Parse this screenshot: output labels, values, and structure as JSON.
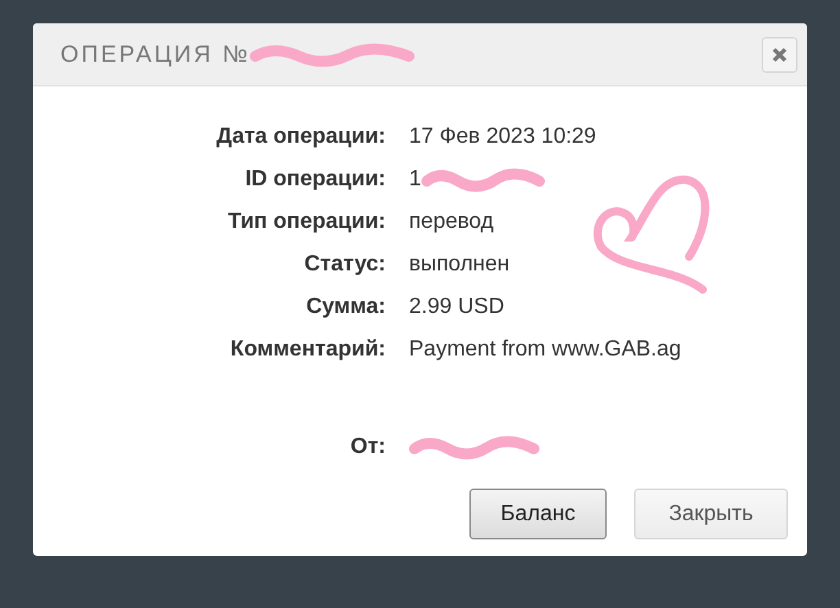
{
  "dialog": {
    "title": "ОПЕРАЦИЯ №",
    "title_redacted": true
  },
  "fields": [
    {
      "label": "Дата операции:",
      "value": "17 Фев 2023 10:29",
      "redacted": false
    },
    {
      "label": "ID операции:",
      "value": "1",
      "redacted": true
    },
    {
      "label": "Тип операции:",
      "value": "перевод",
      "redacted": false
    },
    {
      "label": "Статус:",
      "value": "выполнен",
      "redacted": false
    },
    {
      "label": "Сумма:",
      "value": "2.99 USD",
      "redacted": false
    },
    {
      "label": "Комментарий:",
      "value": "Payment from www.GAB.ag",
      "redacted": false
    }
  ],
  "sender": {
    "label": "От:",
    "redacted": true
  },
  "buttons": [
    {
      "label": "Баланс",
      "focused": true
    },
    {
      "label": "Закрыть",
      "focused": false
    }
  ]
}
